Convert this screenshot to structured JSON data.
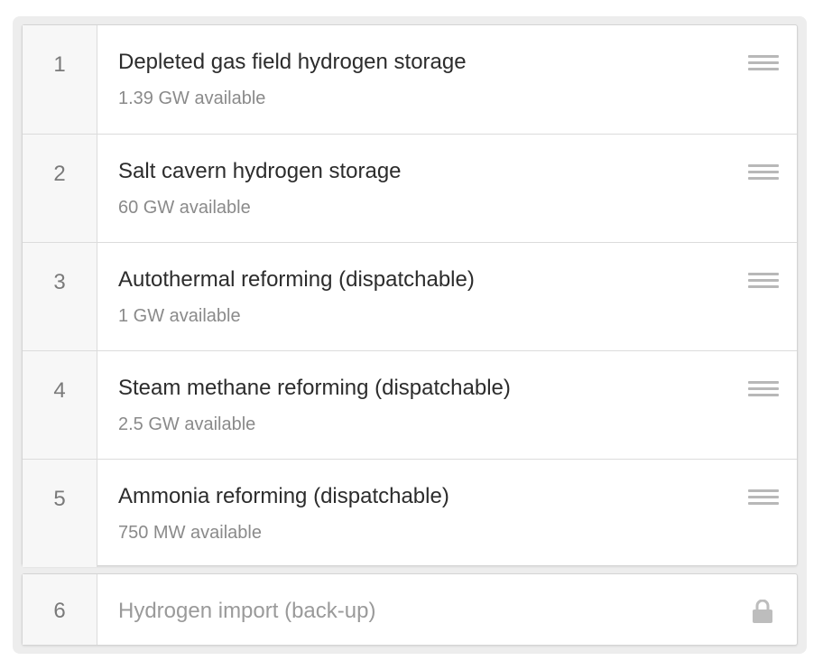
{
  "items": [
    {
      "rank": "1",
      "title": "Depleted gas field hydrogen storage",
      "subtitle": "1.39 GW available"
    },
    {
      "rank": "2",
      "title": "Salt cavern hydrogen storage",
      "subtitle": "60 GW available"
    },
    {
      "rank": "3",
      "title": "Autothermal reforming (dispatchable)",
      "subtitle": "1 GW available"
    },
    {
      "rank": "4",
      "title": "Steam methane reforming (dispatchable)",
      "subtitle": "2.5 GW available"
    },
    {
      "rank": "5",
      "title": "Ammonia reforming (dispatchable)",
      "subtitle": "750 MW available"
    }
  ],
  "locked_item": {
    "rank": "6",
    "title": "Hydrogen import (back-up)",
    "icon": "lock-icon"
  },
  "colors": {
    "panel_bg": "#ededed",
    "handle": "#b8b8b8",
    "lock": "#bdbdbd"
  }
}
